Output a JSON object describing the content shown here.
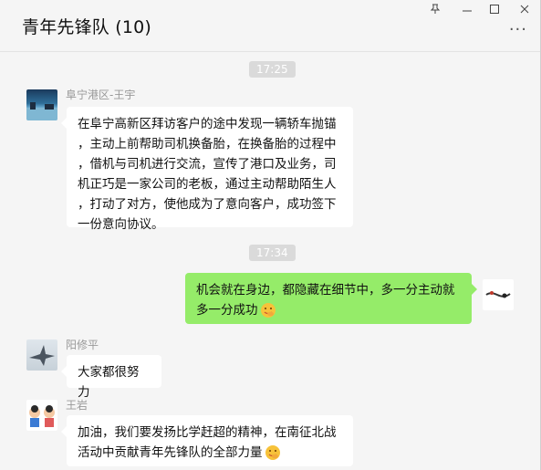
{
  "window": {
    "title": "青年先锋队 (10)",
    "controls": {
      "pin_icon": "pin-icon",
      "minimize_icon": "minimize-icon",
      "maximize_icon": "maximize-icon",
      "close_icon": "close-icon"
    },
    "more_label": "···"
  },
  "messages": {
    "time1": "17:25",
    "m1": {
      "sender": "阜宁港区-王宇",
      "lines": [
        "在阜宁高新区拜访客户的途中发现一辆轿车抛锚",
        "，主动上前帮助司机换备胎，在换备胎的过程中",
        "，借机与司机进行交流，宣传了港口及业务，司",
        "机正巧是一家公司的老板，通过主动帮助陌生人",
        "，打动了对方，使他成为了意向客户，成功签下",
        "一份意向协议。"
      ]
    },
    "time2": "17:34",
    "m2": {
      "lines": [
        "机会就在身边，都隐藏在细节中，多一分主动就",
        "多一分成功"
      ],
      "emoji": "smiling-face-with-hand-over-mouth-emoji"
    },
    "m3": {
      "sender": "阳修平",
      "text": "大家都很努力"
    },
    "m4": {
      "sender": "王岩",
      "lines": [
        "加油，我们要发扬比学赶超的精神，在南征北战",
        "活动中贡献青年先锋队的全部力量"
      ],
      "emoji": "smiling-face-with-hand-over-mouth-emoji"
    }
  },
  "colors": {
    "self_bubble": "#95ec69",
    "other_bubble": "#ffffff",
    "background": "#f5f5f5",
    "timestamp_bg": "#dadada"
  }
}
